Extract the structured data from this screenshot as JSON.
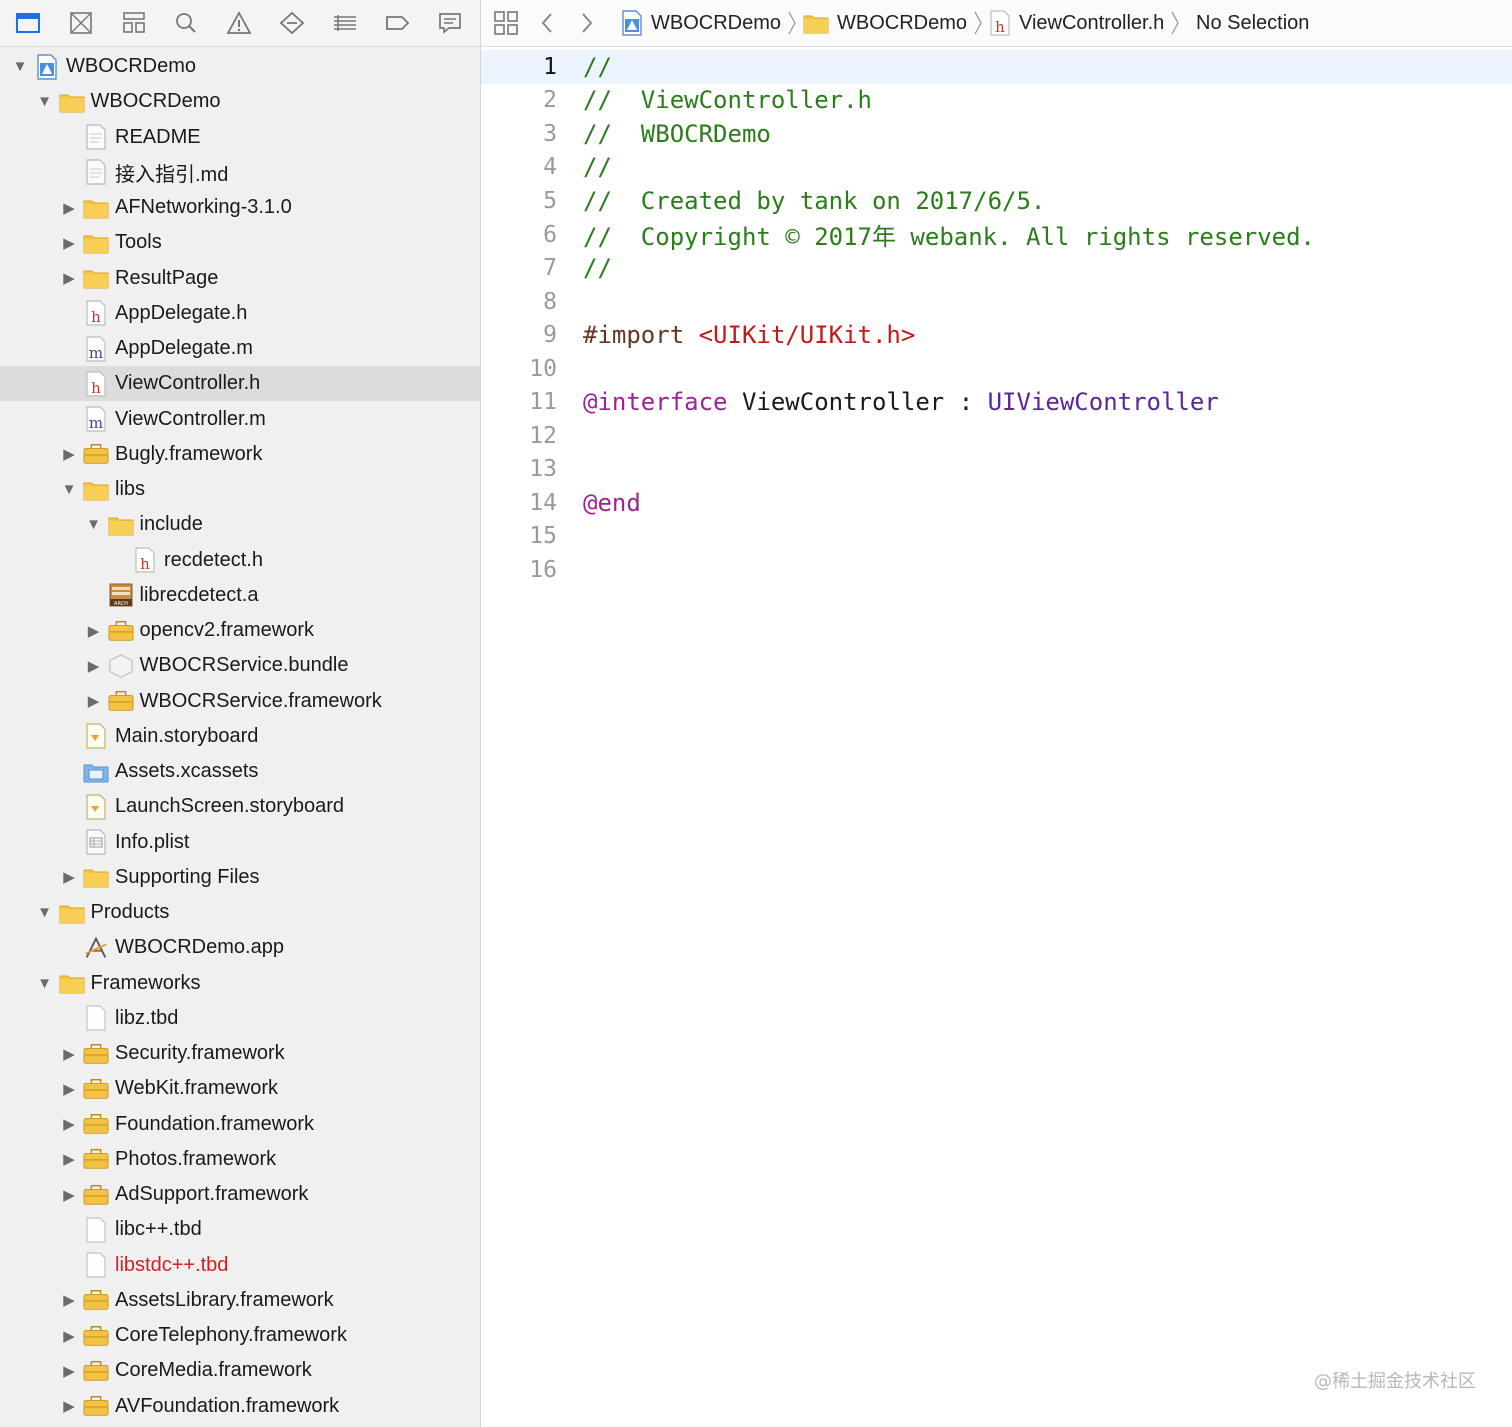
{
  "navigator": {
    "toolbar_icons": [
      "project-navigator-icon",
      "source-control-icon",
      "symbol-navigator-icon",
      "find-icon",
      "issue-icon",
      "test-icon",
      "debug-icon",
      "breakpoint-icon",
      "report-icon"
    ],
    "tree": [
      {
        "label": "WBOCRDemo",
        "depth": 0,
        "disclosure": "open",
        "icon": "project"
      },
      {
        "label": "WBOCRDemo",
        "depth": 1,
        "disclosure": "open",
        "icon": "folder"
      },
      {
        "label": "README",
        "depth": 2,
        "disclosure": "none",
        "icon": "doc"
      },
      {
        "label": "接入指引.md",
        "depth": 2,
        "disclosure": "none",
        "icon": "doc"
      },
      {
        "label": "AFNetworking-3.1.0",
        "depth": 2,
        "disclosure": "closed",
        "icon": "folder"
      },
      {
        "label": "Tools",
        "depth": 2,
        "disclosure": "closed",
        "icon": "folder"
      },
      {
        "label": "ResultPage",
        "depth": 2,
        "disclosure": "closed",
        "icon": "folder"
      },
      {
        "label": "AppDelegate.h",
        "depth": 2,
        "disclosure": "none",
        "icon": "h"
      },
      {
        "label": "AppDelegate.m",
        "depth": 2,
        "disclosure": "none",
        "icon": "m"
      },
      {
        "label": "ViewController.h",
        "depth": 2,
        "disclosure": "none",
        "icon": "h",
        "selected": true
      },
      {
        "label": "ViewController.m",
        "depth": 2,
        "disclosure": "none",
        "icon": "m"
      },
      {
        "label": "Bugly.framework",
        "depth": 2,
        "disclosure": "closed",
        "icon": "framework"
      },
      {
        "label": "libs",
        "depth": 2,
        "disclosure": "open",
        "icon": "folder"
      },
      {
        "label": "include",
        "depth": 3,
        "disclosure": "open",
        "icon": "folder"
      },
      {
        "label": "recdetect.h",
        "depth": 4,
        "disclosure": "none",
        "icon": "h"
      },
      {
        "label": "librecdetect.a",
        "depth": 3,
        "disclosure": "none",
        "icon": "archive"
      },
      {
        "label": "opencv2.framework",
        "depth": 3,
        "disclosure": "closed",
        "icon": "framework"
      },
      {
        "label": "WBOCRService.bundle",
        "depth": 3,
        "disclosure": "closed",
        "icon": "bundle"
      },
      {
        "label": "WBOCRService.framework",
        "depth": 3,
        "disclosure": "closed",
        "icon": "framework"
      },
      {
        "label": "Main.storyboard",
        "depth": 2,
        "disclosure": "none",
        "icon": "storyboard"
      },
      {
        "label": "Assets.xcassets",
        "depth": 2,
        "disclosure": "none",
        "icon": "assets"
      },
      {
        "label": "LaunchScreen.storyboard",
        "depth": 2,
        "disclosure": "none",
        "icon": "storyboard"
      },
      {
        "label": "Info.plist",
        "depth": 2,
        "disclosure": "none",
        "icon": "plist"
      },
      {
        "label": "Supporting Files",
        "depth": 2,
        "disclosure": "closed",
        "icon": "folder"
      },
      {
        "label": "Products",
        "depth": 1,
        "disclosure": "open",
        "icon": "folder"
      },
      {
        "label": "WBOCRDemo.app",
        "depth": 2,
        "disclosure": "none",
        "icon": "app"
      },
      {
        "label": "Frameworks",
        "depth": 1,
        "disclosure": "open",
        "icon": "folder"
      },
      {
        "label": "libz.tbd",
        "depth": 2,
        "disclosure": "none",
        "icon": "blank"
      },
      {
        "label": "Security.framework",
        "depth": 2,
        "disclosure": "closed",
        "icon": "framework"
      },
      {
        "label": "WebKit.framework",
        "depth": 2,
        "disclosure": "closed",
        "icon": "framework"
      },
      {
        "label": "Foundation.framework",
        "depth": 2,
        "disclosure": "closed",
        "icon": "framework"
      },
      {
        "label": "Photos.framework",
        "depth": 2,
        "disclosure": "closed",
        "icon": "framework"
      },
      {
        "label": "AdSupport.framework",
        "depth": 2,
        "disclosure": "closed",
        "icon": "framework"
      },
      {
        "label": "libc++.tbd",
        "depth": 2,
        "disclosure": "none",
        "icon": "blank"
      },
      {
        "label": "libstdc++.tbd",
        "depth": 2,
        "disclosure": "none",
        "icon": "blank",
        "missing": true
      },
      {
        "label": "AssetsLibrary.framework",
        "depth": 2,
        "disclosure": "closed",
        "icon": "framework"
      },
      {
        "label": "CoreTelephony.framework",
        "depth": 2,
        "disclosure": "closed",
        "icon": "framework"
      },
      {
        "label": "CoreMedia.framework",
        "depth": 2,
        "disclosure": "closed",
        "icon": "framework"
      },
      {
        "label": "AVFoundation.framework",
        "depth": 2,
        "disclosure": "closed",
        "icon": "framework"
      }
    ]
  },
  "jump_bar": {
    "related_icon": "related-items-icon",
    "back_icon": "chevron-left-icon",
    "forward_icon": "chevron-right-icon",
    "crumbs": [
      {
        "label": "WBOCRDemo",
        "icon": "project"
      },
      {
        "label": "WBOCRDemo",
        "icon": "folder"
      },
      {
        "label": "ViewController.h",
        "icon": "h"
      },
      {
        "label": "No Selection",
        "icon": ""
      }
    ]
  },
  "editor": {
    "current_line": 1,
    "lines": [
      [
        {
          "t": "//",
          "c": "comment"
        }
      ],
      [
        {
          "t": "//  ViewController.h",
          "c": "comment"
        }
      ],
      [
        {
          "t": "//  WBOCRDemo",
          "c": "comment"
        }
      ],
      [
        {
          "t": "//",
          "c": "comment"
        }
      ],
      [
        {
          "t": "//  Created by tank on 2017/6/5.",
          "c": "comment"
        }
      ],
      [
        {
          "t": "//  Copyright © 2017年 webank. All rights reserved.",
          "c": "comment"
        }
      ],
      [
        {
          "t": "//",
          "c": "comment"
        }
      ],
      [],
      [
        {
          "t": "#import ",
          "c": "directive"
        },
        {
          "t": "<UIKit/UIKit.h>",
          "c": "inc"
        }
      ],
      [],
      [
        {
          "t": "@interface",
          "c": "kw"
        },
        {
          "t": " ViewController : ",
          "c": "cls"
        },
        {
          "t": "UIViewController",
          "c": "sys"
        }
      ],
      [],
      [],
      [
        {
          "t": "@end",
          "c": "kw"
        }
      ],
      [],
      []
    ]
  },
  "watermark": "@稀土掘金技术社区",
  "colors": {
    "accent": "#1f6fe6",
    "folder": "#f5c542",
    "comment": "#2a7d1a",
    "keyword": "#9b2393",
    "include": "#c41a16",
    "system_class": "#5c2699",
    "missing_file": "#d42020"
  }
}
